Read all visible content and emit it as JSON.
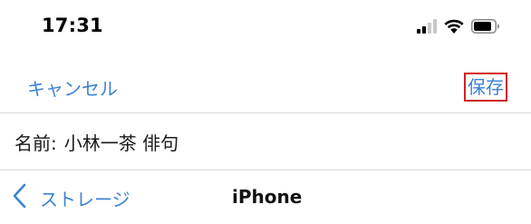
{
  "status_bar": {
    "time": "17:31",
    "icons": [
      "signal-icon",
      "wifi-icon",
      "battery-icon"
    ]
  },
  "nav": {
    "cancel_label": "キャンセル",
    "save_label": "保存"
  },
  "name_field": {
    "label": "名前:",
    "value": "小林一茶 俳句"
  },
  "location": {
    "back_label": "ストレージ",
    "current": "iPhone"
  },
  "colors": {
    "accent": "#3d82d3",
    "highlight_border": "#d02020",
    "divider": "#d8d8d8"
  }
}
